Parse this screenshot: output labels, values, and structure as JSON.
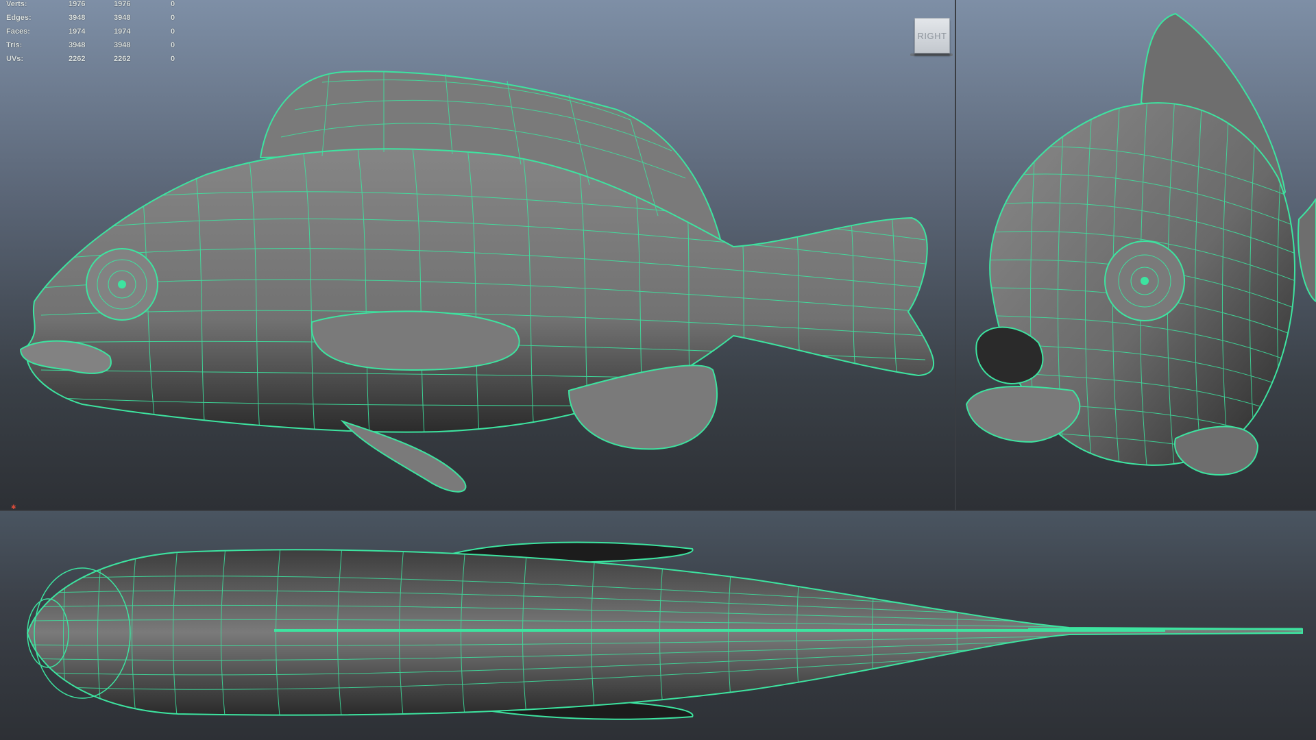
{
  "hud": {
    "rows": [
      {
        "label": "Verts:",
        "v1": "1976",
        "v2": "1976",
        "v3": "0"
      },
      {
        "label": "Edges:",
        "v1": "3948",
        "v2": "3948",
        "v3": "0"
      },
      {
        "label": "Faces:",
        "v1": "1974",
        "v2": "1974",
        "v3": "0"
      },
      {
        "label": "Tris:",
        "v1": "3948",
        "v2": "3948",
        "v3": "0"
      },
      {
        "label": "UVs:",
        "v1": "2262",
        "v2": "2262",
        "v3": "0"
      }
    ]
  },
  "view_cube": {
    "label": "RIGHT"
  },
  "colors": {
    "wire": "#3de4a0",
    "mesh_fill": "#7b7b7b",
    "mesh_dark": "#2a2a2a",
    "bg_top": "#7e8fa6",
    "bg_bottom": "#2d3035"
  },
  "axis_marker": {
    "icon": "axis-gizmo-icon"
  }
}
